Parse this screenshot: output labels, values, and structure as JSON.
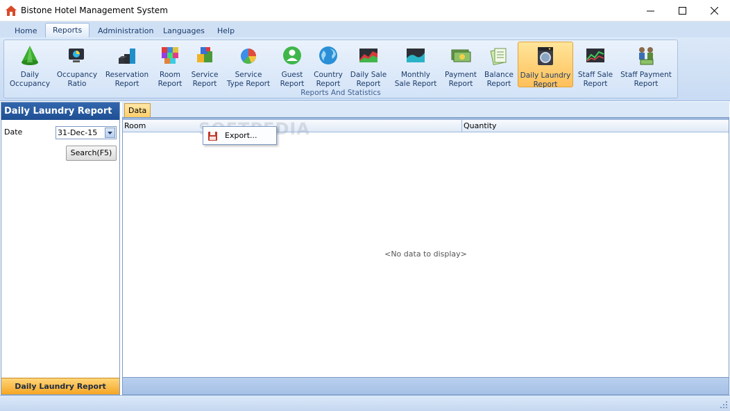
{
  "window": {
    "title": "Bistone Hotel Management System"
  },
  "menu": {
    "tabs": [
      {
        "label": "Home"
      },
      {
        "label": "Reports"
      },
      {
        "label": "Administration"
      },
      {
        "label": "Languages"
      },
      {
        "label": "Help"
      }
    ],
    "active": "Reports"
  },
  "ribbon": {
    "group_label": "Reports And Statistics",
    "buttons": [
      {
        "label": "Daily\nOccupancy",
        "icon": "green-cone-icon"
      },
      {
        "label": "Occupancy\nRatio",
        "icon": "monitor-pie-icon"
      },
      {
        "label": "Reservation\nReport",
        "icon": "blocks-stairs-icon"
      },
      {
        "label": "Room\nReport",
        "icon": "colored-cubes-icon"
      },
      {
        "label": "Service\nReport",
        "icon": "colored-boxes-icon"
      },
      {
        "label": "Service\nType Report",
        "icon": "pie-chart-icon"
      },
      {
        "label": "Guest\nReport",
        "icon": "user-circle-icon"
      },
      {
        "label": "Country\nReport",
        "icon": "globe-icon"
      },
      {
        "label": "Daily Sale\nReport",
        "icon": "area-chart-icon"
      },
      {
        "label": "Monthly\nSale Report",
        "icon": "wave-chart-icon"
      },
      {
        "label": "Payment\nReport",
        "icon": "money-icon"
      },
      {
        "label": "Balance\nReport",
        "icon": "documents-icon"
      },
      {
        "label": "Daily Laundry\nReport",
        "icon": "washing-machine-icon"
      },
      {
        "label": "Staff Sale\nReport",
        "icon": "line-chart-icon"
      },
      {
        "label": "Staff Payment\nReport",
        "icon": "people-money-icon"
      }
    ],
    "active": "Daily Laundry\nReport"
  },
  "left_panel": {
    "title": "Daily Laundry Report",
    "date_label": "Date",
    "date_value": "31-Dec-15",
    "search_label": "Search(F5)",
    "footer": "Daily Laundry Report"
  },
  "main": {
    "tab_label": "Data",
    "columns": [
      "Room",
      "Quantity"
    ],
    "empty_text": "<No data to display>"
  },
  "context_menu": {
    "items": [
      {
        "label": "Export...",
        "icon": "export-disk-icon"
      }
    ]
  },
  "watermark": "SOFTPEDIA"
}
